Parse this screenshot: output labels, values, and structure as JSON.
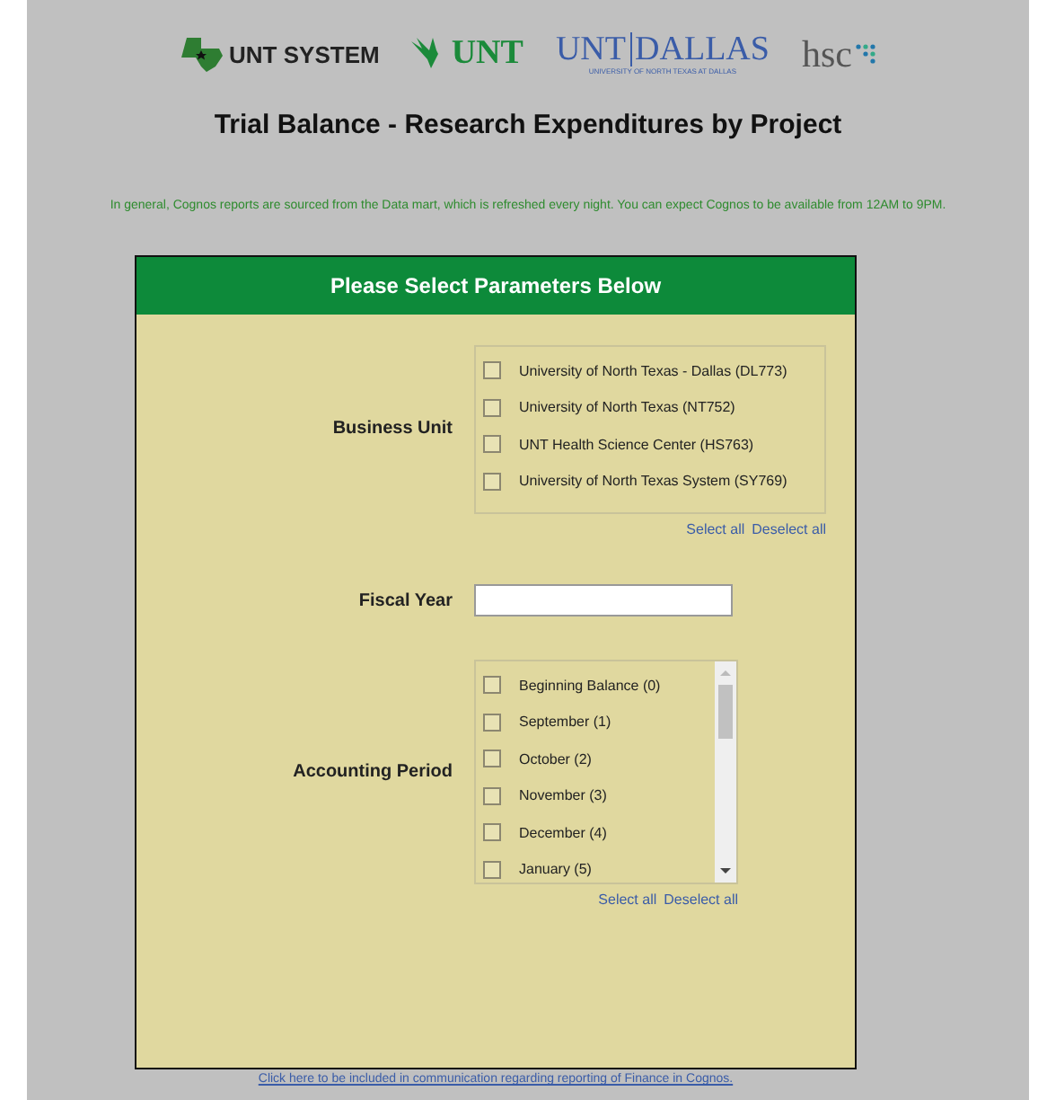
{
  "logos": [
    {
      "kind": "system",
      "text": "UNT SYSTEM"
    },
    {
      "kind": "unt",
      "text": "UNT"
    },
    {
      "kind": "dallas",
      "text": "UNT",
      "text2": "DALLAS",
      "subtitle": "UNIVERSITY OF NORTH TEXAS AT DALLAS"
    },
    {
      "kind": "hsc",
      "text": "hsc"
    }
  ],
  "title": "Trial Balance - Research Expenditures by Project",
  "notice": "In general, Cognos reports are sourced from the Data mart, which is refreshed every night. You can expect Cognos to be available from 12AM to 9PM.",
  "panel": {
    "header": "Please Select Parameters Below",
    "parameters": [
      {
        "kind": "checklist",
        "label": "Business Unit",
        "scroll": false,
        "options": [
          {
            "label": "University of North Texas - Dallas (DL773)",
            "checked": false
          },
          {
            "label": "University of North Texas (NT752)",
            "checked": false
          },
          {
            "label": "UNT Health Science Center (HS763)",
            "checked": false
          },
          {
            "label": "University of North Texas System (SY769)",
            "checked": false
          }
        ],
        "links": [
          "Select all",
          "Deselect all"
        ]
      },
      {
        "kind": "text",
        "label": "Fiscal Year"
      },
      {
        "kind": "checklist",
        "label": "Accounting Period",
        "scroll": true,
        "options": [
          {
            "label": "Beginning Balance (0)",
            "checked": false
          },
          {
            "label": "September (1)",
            "checked": false
          },
          {
            "label": "October (2)",
            "checked": false
          },
          {
            "label": "November (3)",
            "checked": false
          },
          {
            "label": "December (4)",
            "checked": false
          },
          {
            "label": "January (5)",
            "checked": false
          }
        ],
        "links": [
          "Select all",
          "Deselect all"
        ]
      }
    ]
  },
  "footer_link": "Click here to be included in communication regarding reporting of Finance in Cognos."
}
